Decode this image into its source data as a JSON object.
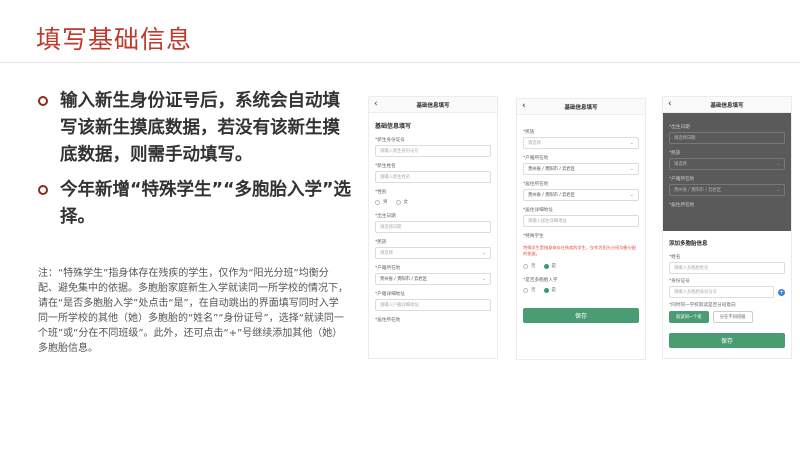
{
  "slide": {
    "title": "填写基础信息",
    "bullets": [
      "输入新生身份证号后，系统会自动填写该新生摸底数据，若没有该新生摸底数据，则需手动填写。",
      "今年新增“特殊学生”“多胞胎入学”选择。"
    ],
    "note": "注：“特殊学生”指身体存在残疾的学生，仅作为“阳光分班”均衡分配、避免集中的依据。多胞胎家庭新生入学就读同一所学校的情况下，请在“是否多胞胎入学”处点击“是”，在自动跳出的界面填写同时入学同一所学校的其他（她）多胞胎的“姓名”“身份证号”，选择“就读同一个班”或“分在不同班级”。此外，还可点击“+”号继续添加其他（她）多胞胎信息。"
  },
  "phone1": {
    "header": "基础信息填写",
    "section": "基础信息填写",
    "fields": {
      "id_label": "*新生身份证号",
      "id_ph": "请输入新生身份证号",
      "name_label": "*新生姓名",
      "name_ph": "请输入新生姓名",
      "gender_label": "*性别",
      "gender_a": "男",
      "gender_b": "女",
      "birth_label": "*出生日期",
      "birth_ph": "请选择日期",
      "ethnic_label": "*民族",
      "ethnic_val": "请选择",
      "hukou_label": "*户籍所在地",
      "hukou_val": "贵州省 / 贵阳市 / 云岩区",
      "hukou_addr_label": "*户籍详细地址",
      "hukou_addr_ph": "请输入户籍详细地址",
      "residence_label": "*居住所在地"
    }
  },
  "phone2": {
    "header": "基础信息填写",
    "ethnic_label": "*民族",
    "ethnic_val": "请选择",
    "hukou_label": "*户籍所在地",
    "hukou_val": "贵州省 / 贵阳市 / 云岩区",
    "residence_label": "*居住所在地",
    "residence_val": "贵州省 / 贵阳市 / 云岩区",
    "res_addr_label": "*居住详细地址",
    "res_addr_ph": "请输入居住详细地址",
    "special_label": "*特殊学生",
    "special_warning": "特殊学生是指身体存在残疾的学生，仅作为阳光分班均衡分配的依据。",
    "special_no": "否",
    "special_yes": "是",
    "multi_label": "*是否多胞胎入学",
    "multi_no": "否",
    "multi_yes": "是",
    "save": "保存"
  },
  "phone3": {
    "header": "基础信息填写",
    "birth_label": "*出生日期",
    "birth_ph": "请选择日期",
    "ethnic_label": "*民族",
    "ethnic_val": "请选择",
    "hukou_label": "*户籍所在地",
    "hukou_val": "贵州省 / 贵阳市 / 云岩区",
    "residence_label": "*居住所在地",
    "dialog_title": "添加多胞胎信息",
    "d_name_label": "*姓名",
    "d_name_ph": "请输入多胞胎姓名",
    "d_id_label": "*身份证号",
    "d_id_ph": "请输入多胞胎身份证号",
    "d_class_label": "*同时同一学校就读是否分班意向",
    "d_same": "就读同一个班",
    "d_diff": "分在不同班级",
    "save": "保存"
  }
}
